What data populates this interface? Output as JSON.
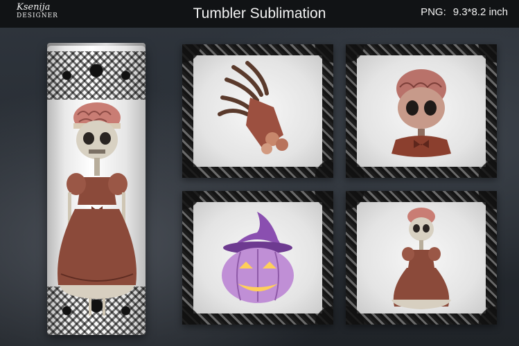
{
  "brand": {
    "line1": "Ksenija",
    "line2": "DESIGNER"
  },
  "title": "Tumbler Sublimation",
  "spec": {
    "format": "PNG:",
    "size": "9.3*8.2 inch"
  },
  "colors": {
    "topbar": "#111315",
    "background": "#2b3138",
    "dress": "#8b4a3a",
    "brain": "#c97d74",
    "hat": "#8a4fb0",
    "pumpkin": "#c08fd6"
  },
  "tiles": [
    {
      "subject": "skeleton-hand-icon"
    },
    {
      "subject": "doll-head-icon"
    },
    {
      "subject": "pumpkin-witch-hat-icon"
    },
    {
      "subject": "skeleton-doll-icon"
    }
  ]
}
